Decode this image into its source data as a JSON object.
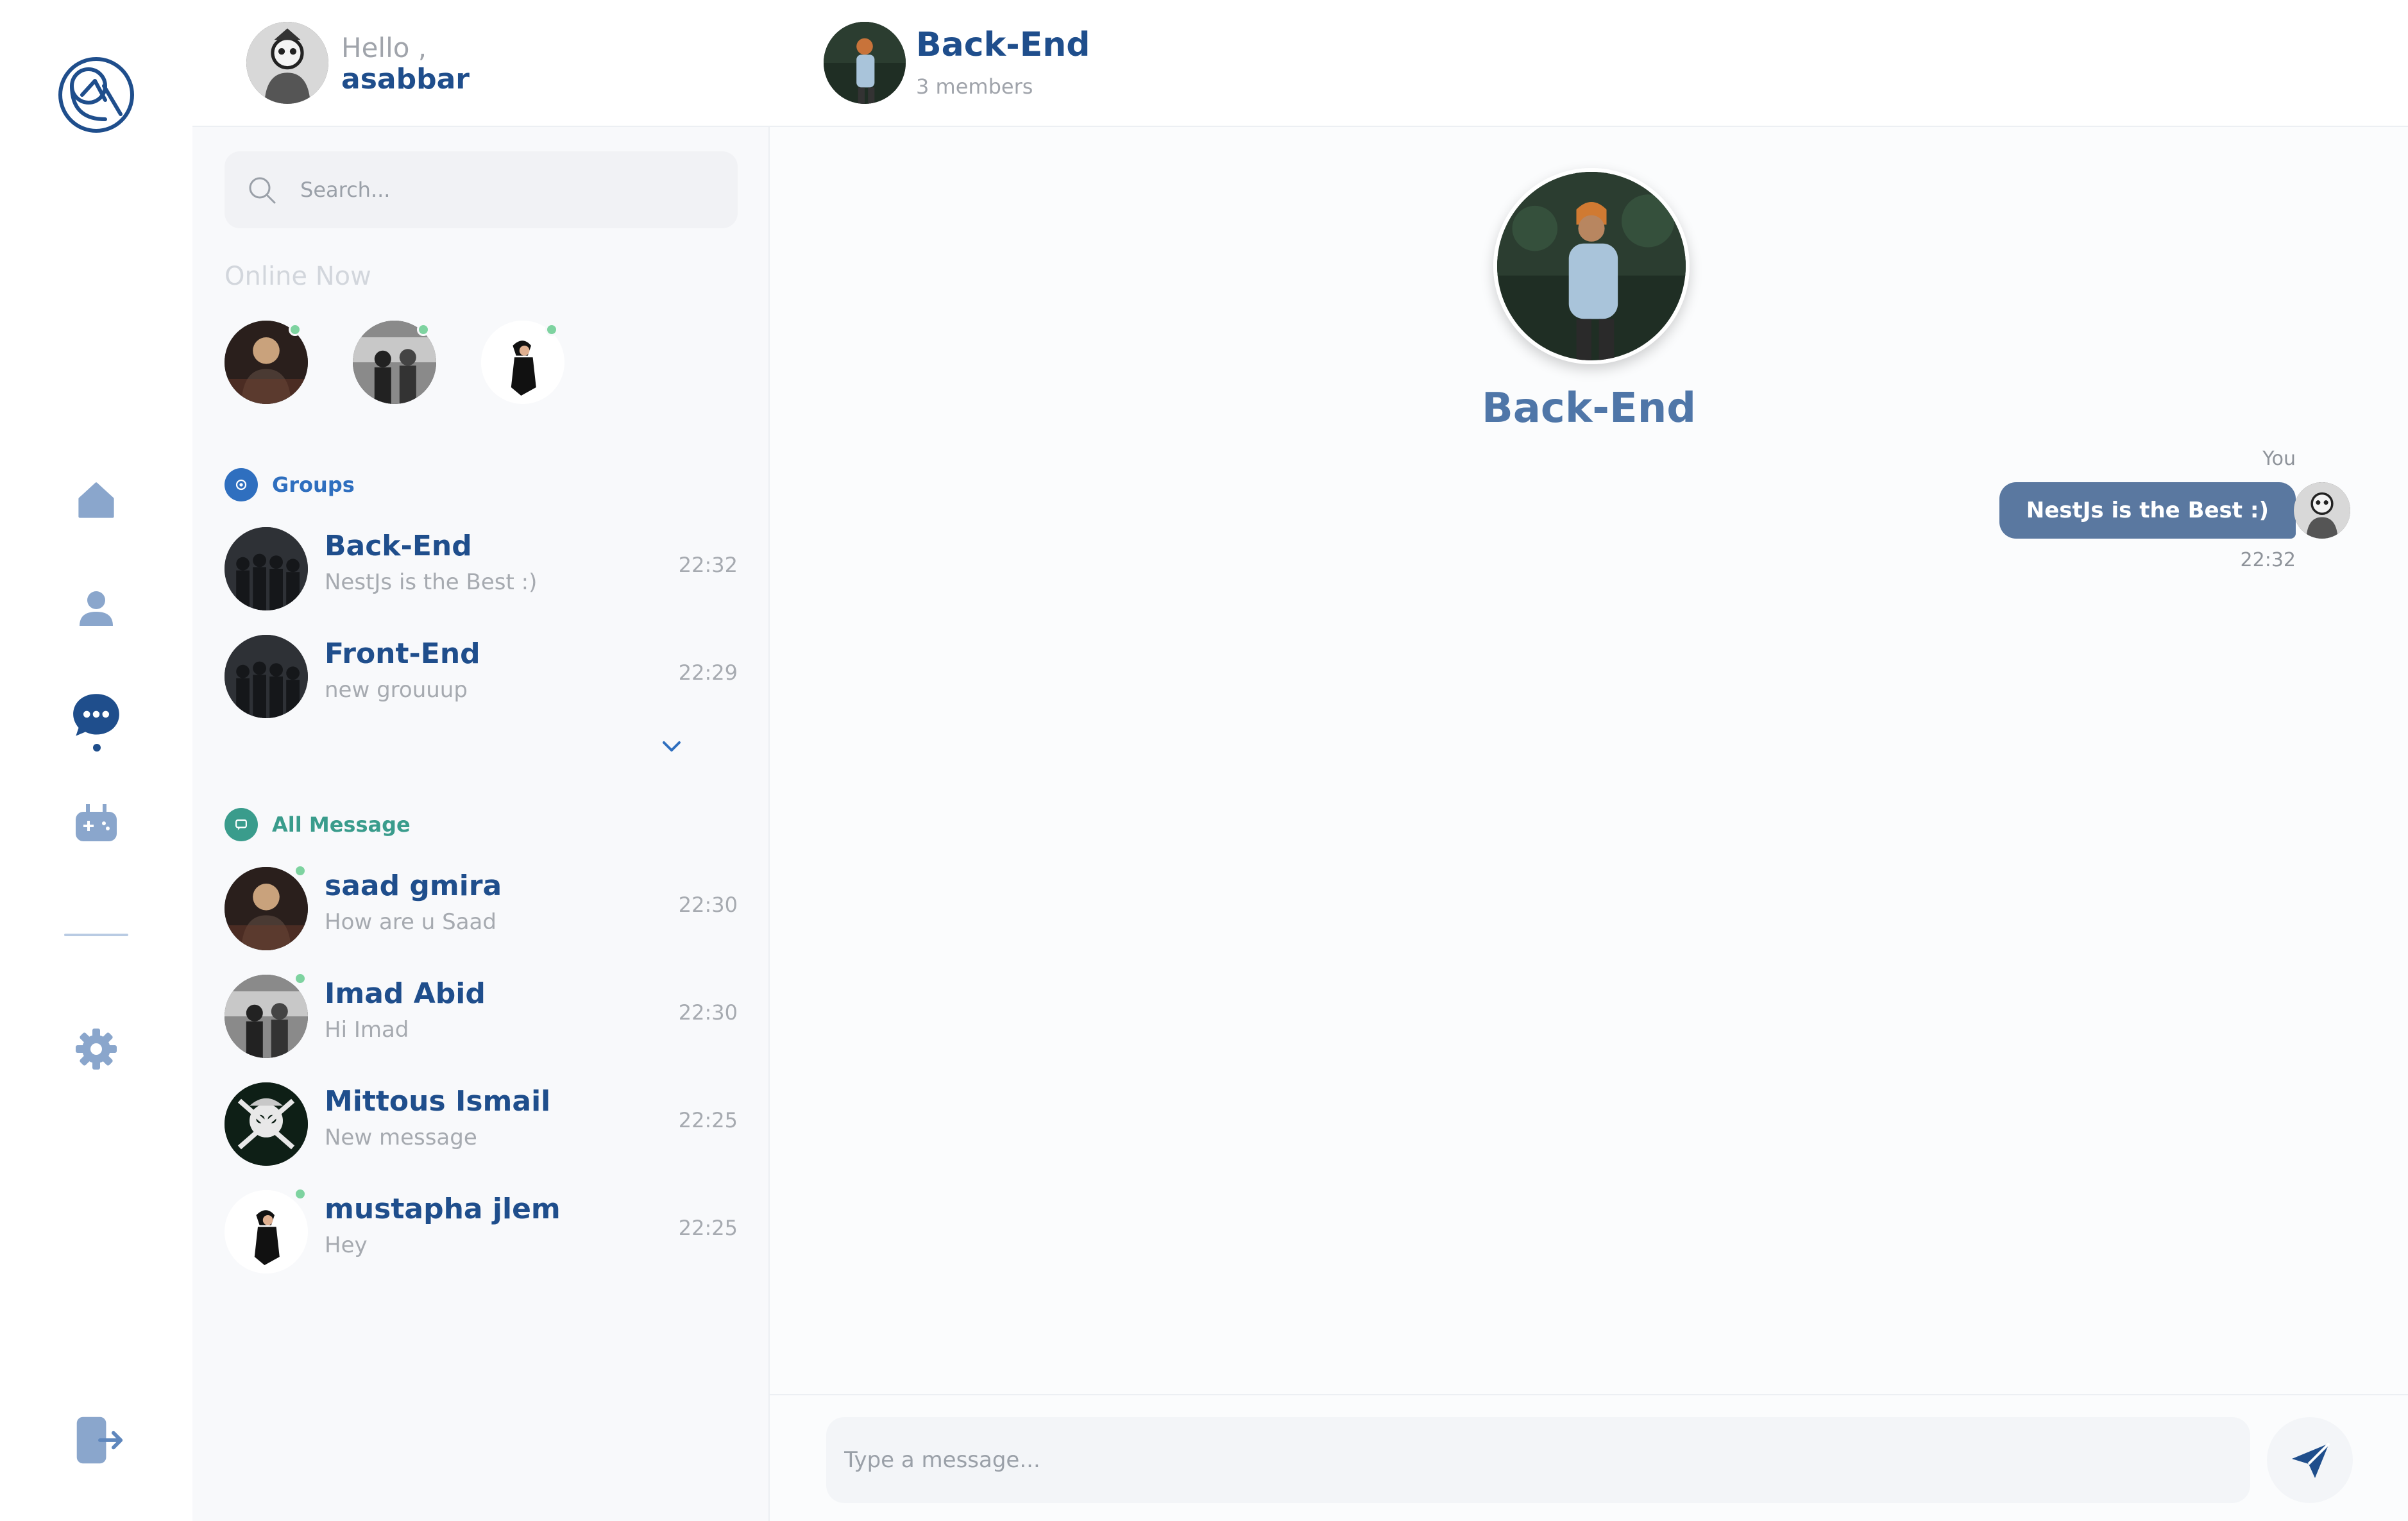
{
  "user": {
    "greeting": "Hello ,",
    "name": "asabbar"
  },
  "nav": {
    "items": [
      {
        "icon": "home-icon"
      },
      {
        "icon": "profile-icon"
      },
      {
        "icon": "chat-icon"
      },
      {
        "icon": "game-icon"
      },
      {
        "icon": "settings-icon"
      },
      {
        "icon": "logout-icon"
      }
    ]
  },
  "search": {
    "placeholder": "Search..."
  },
  "online": {
    "title": "Online Now"
  },
  "groups": {
    "title": "Groups",
    "items": [
      {
        "name": "Back-End",
        "last": "NestJs is the Best :)",
        "time": "22:32"
      },
      {
        "name": "Front-End",
        "last": "new grouuup",
        "time": "22:29"
      }
    ]
  },
  "messages": {
    "title": "All Message",
    "items": [
      {
        "name": "saad gmira",
        "last": "How are u Saad",
        "time": "22:30"
      },
      {
        "name": "Imad Abid",
        "last": "Hi Imad",
        "time": "22:30"
      },
      {
        "name": "Mittous Ismail",
        "last": "New message",
        "time": "22:25"
      },
      {
        "name": "mustapha jlem",
        "last": "Hey",
        "time": "22:25"
      }
    ]
  },
  "chat": {
    "title": "Back-End",
    "subtitle": "3 members",
    "big_title": "Back-End",
    "message": {
      "sender": "You",
      "text": "NestJs is the Best :)",
      "time": "22:32"
    },
    "composer_placeholder": "Type a message..."
  },
  "colors": {
    "primary": "#1f4e8c",
    "bubble": "#5a78a0",
    "online": "#7ed3a0",
    "icon_muted": "#8aa6cc"
  }
}
